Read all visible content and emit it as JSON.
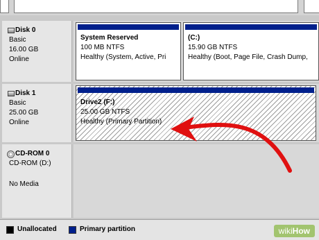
{
  "disks": [
    {
      "name": "Disk 0",
      "type": "Basic",
      "size": "16.00 GB",
      "status": "Online",
      "volumes": [
        {
          "title": "System Reserved",
          "detail": "100 MB NTFS",
          "health": "Healthy (System, Active, Pri"
        },
        {
          "title": "(C:)",
          "detail": "15.90 GB NTFS",
          "health": "Healthy (Boot, Page File, Crash Dump,"
        }
      ]
    },
    {
      "name": "Disk 1",
      "type": "Basic",
      "size": "25.00 GB",
      "status": "Online",
      "volumes": [
        {
          "title": "Drive2  (F:)",
          "detail": "25.00 GB NTFS",
          "health": "Healthy (Primary Partition)"
        }
      ]
    }
  ],
  "cdrom": {
    "name": "CD-ROM 0",
    "type": "CD-ROM (D:)",
    "status": "No Media"
  },
  "legend": [
    {
      "label": "Unallocated",
      "color": "#000000"
    },
    {
      "label": "Primary partition",
      "color": "#00208c"
    }
  ],
  "watermark": {
    "wiki": "wiki",
    "how": "How"
  },
  "colors": {
    "primary_bar": "#00208c",
    "annotation_arrow": "#e01010"
  },
  "annotation": {
    "icon": "red-arrow",
    "points_to": "disks.1.volumes.0.health"
  }
}
